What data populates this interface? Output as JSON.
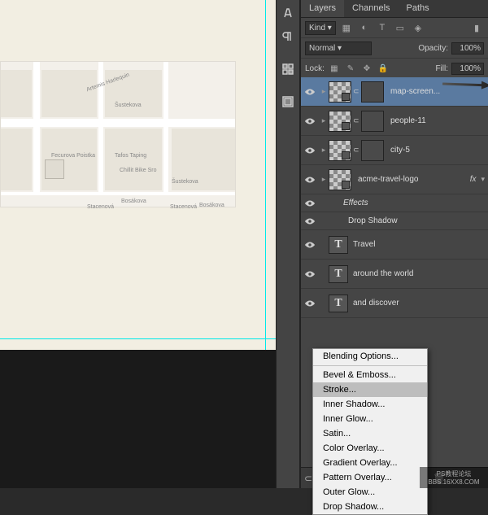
{
  "canvas": {
    "map_labels": {
      "l1": "Šustekova",
      "l2": "Fecurova Poistka",
      "l3": "Tafos Taping",
      "l4": "Chillit Bike Sro",
      "l5": "Šustekova",
      "l6": "Bosákova",
      "l7": "Stacenová",
      "l8": "Stacenová",
      "l9": "Bosákova",
      "l10": "Artemis Harlequin"
    }
  },
  "panel": {
    "tabs": [
      "Layers",
      "Channels",
      "Paths"
    ],
    "filter": {
      "kind": "Kind",
      "opacity_label": "Opacity:",
      "fill_label": "Fill:"
    },
    "blend": {
      "mode": "Normal",
      "opacity": "100%",
      "fill": "100%"
    },
    "lock_label": "Lock:",
    "layers": [
      {
        "name": "map-screen...",
        "selected": true,
        "smart": true,
        "masked": true
      },
      {
        "name": "people-11",
        "smart": true,
        "masked": true
      },
      {
        "name": "city-5",
        "smart": true,
        "masked": true
      },
      {
        "name": "acme-travel-logo",
        "fx": true
      },
      {
        "name": "Effects",
        "sub": true
      },
      {
        "name": "Drop Shadow",
        "sub2": true
      },
      {
        "name": "Travel",
        "text": true
      },
      {
        "name": "around the world",
        "text": true
      },
      {
        "name": "and discover",
        "text": true
      }
    ]
  },
  "fx_menu": {
    "items": [
      "Blending Options...",
      "Bevel & Emboss...",
      "Stroke...",
      "Inner Shadow...",
      "Inner Glow...",
      "Satin...",
      "Color Overlay...",
      "Gradient Overlay...",
      "Pattern Overlay...",
      "Outer Glow...",
      "Drop Shadow..."
    ],
    "highlighted": "Stroke..."
  },
  "watermark": {
    "l1": "PS教程论坛",
    "l2": "BBS.16XX8.COM"
  }
}
